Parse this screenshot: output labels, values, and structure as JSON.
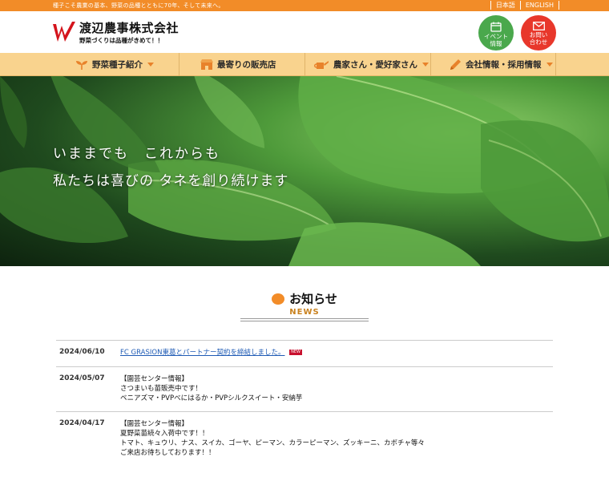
{
  "topbar": {
    "tagline": "種子こそ農業の基本、野菜の品種とともに70年、そして未来へ。",
    "lang_ja": "日本語",
    "lang_en": "ENGLISH"
  },
  "header": {
    "company_name": "渡辺農事株式会社",
    "slogan": "野菜づくりは品種がきめて！！",
    "event_label_1": "イベント",
    "event_label_2": "情報",
    "contact_label_1": "お問い",
    "contact_label_2": "合わせ"
  },
  "nav": {
    "items": [
      {
        "label": "野菜種子紹介",
        "icon": "sprout-icon",
        "dropdown": true
      },
      {
        "label": "最寄りの販売店",
        "icon": "store-icon",
        "dropdown": false
      },
      {
        "label": "農家さん・愛好家さん",
        "icon": "watering-can-icon",
        "dropdown": true
      },
      {
        "label": "会社情報・採用情報",
        "icon": "pencil-icon",
        "dropdown": true
      }
    ]
  },
  "hero": {
    "line1": "いままでも　これからも",
    "line2": "私たちは喜びの タネを創り続けます"
  },
  "news": {
    "title": "お知らせ",
    "subtitle": "NEWS",
    "items": [
      {
        "date": "2024/06/10",
        "lines": [
          "FC GRASION東葛とパートナー契約を締結しました。"
        ],
        "link": true,
        "badge": "NEW"
      },
      {
        "date": "2024/05/07",
        "lines": [
          "【園芸センター情報】",
          "さつまいも苗販売中です！",
          "ベニアズマ・PVPべにはるか・PVPシルクスイート・安納芋"
        ],
        "link": false
      },
      {
        "date": "2024/04/17",
        "lines": [
          "【園芸センター情報】",
          "夏野菜苗続々入荷中です！！",
          "トマト、キュウリ、ナス、スイカ、ゴーヤ、ピーマン、カラーピーマン、ズッキーニ、カボチャ等々",
          "ご来店お待ちしております！！"
        ],
        "link": false
      }
    ]
  },
  "colors": {
    "accent_orange": "#f28c28",
    "nav_bg": "#f9d38e",
    "event_green": "#4aa84c",
    "contact_red": "#e8372b",
    "link_blue": "#1f5bb5"
  }
}
